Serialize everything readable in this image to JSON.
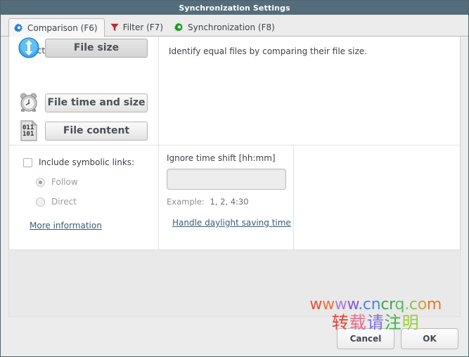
{
  "window": {
    "title": "Synchronization Settings",
    "titlebar_color": "#556d7a"
  },
  "tabs": [
    {
      "label": "Comparison (F6)",
      "icon": "gear-icon",
      "icon_color": "#2a7fc9",
      "active": true
    },
    {
      "label": "Filter (F7)",
      "icon": "funnel-icon",
      "icon_color": "#cc2222",
      "active": false
    },
    {
      "label": "Synchronization (F8)",
      "icon": "gear-icon",
      "icon_color": "#1e9e1e",
      "active": false
    }
  ],
  "comparison": {
    "variant_title": "Select a variant:",
    "variants": [
      {
        "label": "File time and size",
        "icon": "alarm-clock-icon",
        "selected": false
      },
      {
        "label": "File content",
        "icon": "binary-document-icon",
        "selected": false
      },
      {
        "label": "File size",
        "icon": "blue-updown-arrow-icon",
        "selected": true
      }
    ],
    "description": "Identify equal files by comparing their file size.",
    "symbolic_links": {
      "checkbox_label": "Include symbolic links:",
      "checked": false,
      "options": [
        {
          "label": "Follow",
          "selected": true
        },
        {
          "label": "Direct",
          "selected": false
        }
      ],
      "more_info_link": "More information"
    },
    "time_shift": {
      "title": "Ignore time shift [hh:mm]",
      "value": "",
      "placeholder": "",
      "example_label": "Example:",
      "example_values": "1, 2, 4:30",
      "dst_link": "Handle daylight saving time"
    }
  },
  "footer": {
    "cancel_label": "Cancel",
    "ok_label": "OK"
  },
  "watermark": {
    "url_chars": [
      {
        "c": "w",
        "color": "#e8503a"
      },
      {
        "c": "w",
        "color": "#f0703a"
      },
      {
        "c": "w",
        "color": "#b47ad8"
      },
      {
        "c": "w",
        "color": "#7b5fd0"
      },
      {
        "c": ".",
        "color": "#5a7fd8"
      },
      {
        "c": "c",
        "color": "#4a86e8"
      },
      {
        "c": "n",
        "color": "#4a86e8"
      },
      {
        "c": "c",
        "color": "#3fa34a"
      },
      {
        "c": "r",
        "color": "#3fa34a"
      },
      {
        "c": "q",
        "color": "#5fb85f"
      },
      {
        "c": ".",
        "color": "#7ec77e"
      },
      {
        "c": "c",
        "color": "#8fbf4a"
      },
      {
        "c": "o",
        "color": "#c4a838"
      },
      {
        "c": "m",
        "color": "#e07a2a"
      }
    ],
    "cn_chars": [
      {
        "c": "转",
        "color": "#e8403a"
      },
      {
        "c": "载",
        "color": "#e86a8a"
      },
      {
        "c": "请",
        "color": "#7b6fd8"
      },
      {
        "c": "注",
        "color": "#3fb34a"
      },
      {
        "c": "明",
        "color": "#9ccf3a"
      }
    ]
  }
}
